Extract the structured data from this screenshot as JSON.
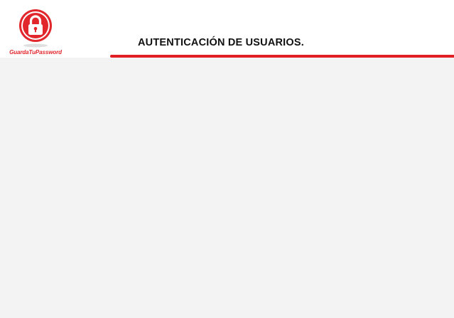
{
  "brand": {
    "name": "GuardaTuPassword",
    "icon": "lock-icon",
    "color": "#e1262c"
  },
  "header": {
    "title": "AUTENTICACIÓN DE USUARIOS.",
    "accent_color": "#e01e24"
  },
  "content": {
    "background": "#f3f3f3"
  }
}
